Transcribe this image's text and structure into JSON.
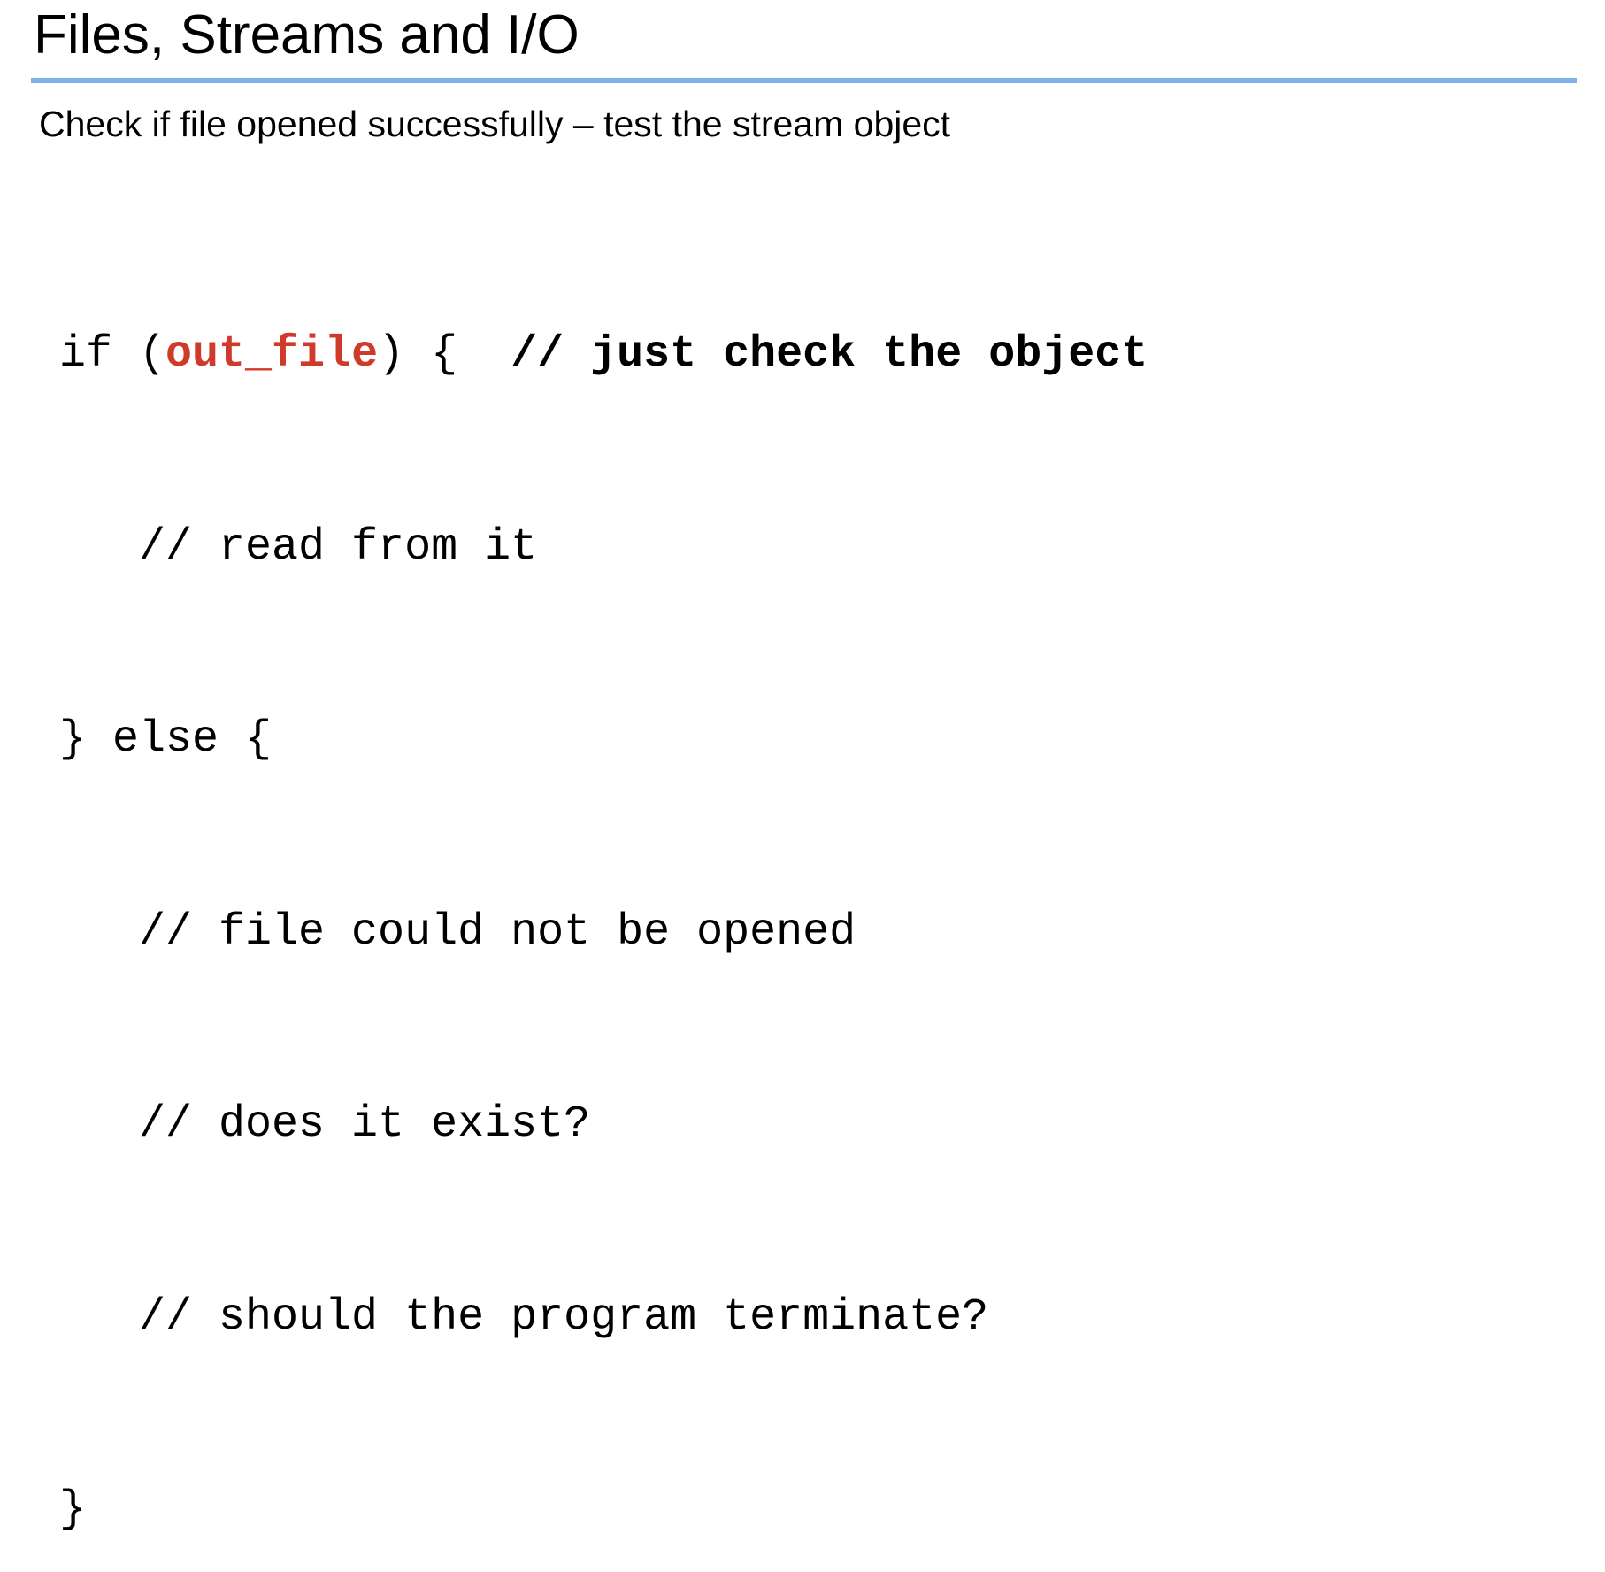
{
  "slide": {
    "title": "Files, Streams and I/O",
    "subtitle": "Check if file opened successfully – test the stream object"
  },
  "code": {
    "line1_pre": "if (",
    "line1_var": "out_file",
    "line1_post": ") {  ",
    "line1_comment": "// just check the object",
    "lines": [
      "   // read from it",
      "} else {",
      "   // file could not be opened",
      "   // does it exist?",
      "   // should the program terminate?",
      "}"
    ]
  },
  "colors": {
    "accent_rule": "#7fb2ea",
    "highlight": "#d03a2a"
  }
}
